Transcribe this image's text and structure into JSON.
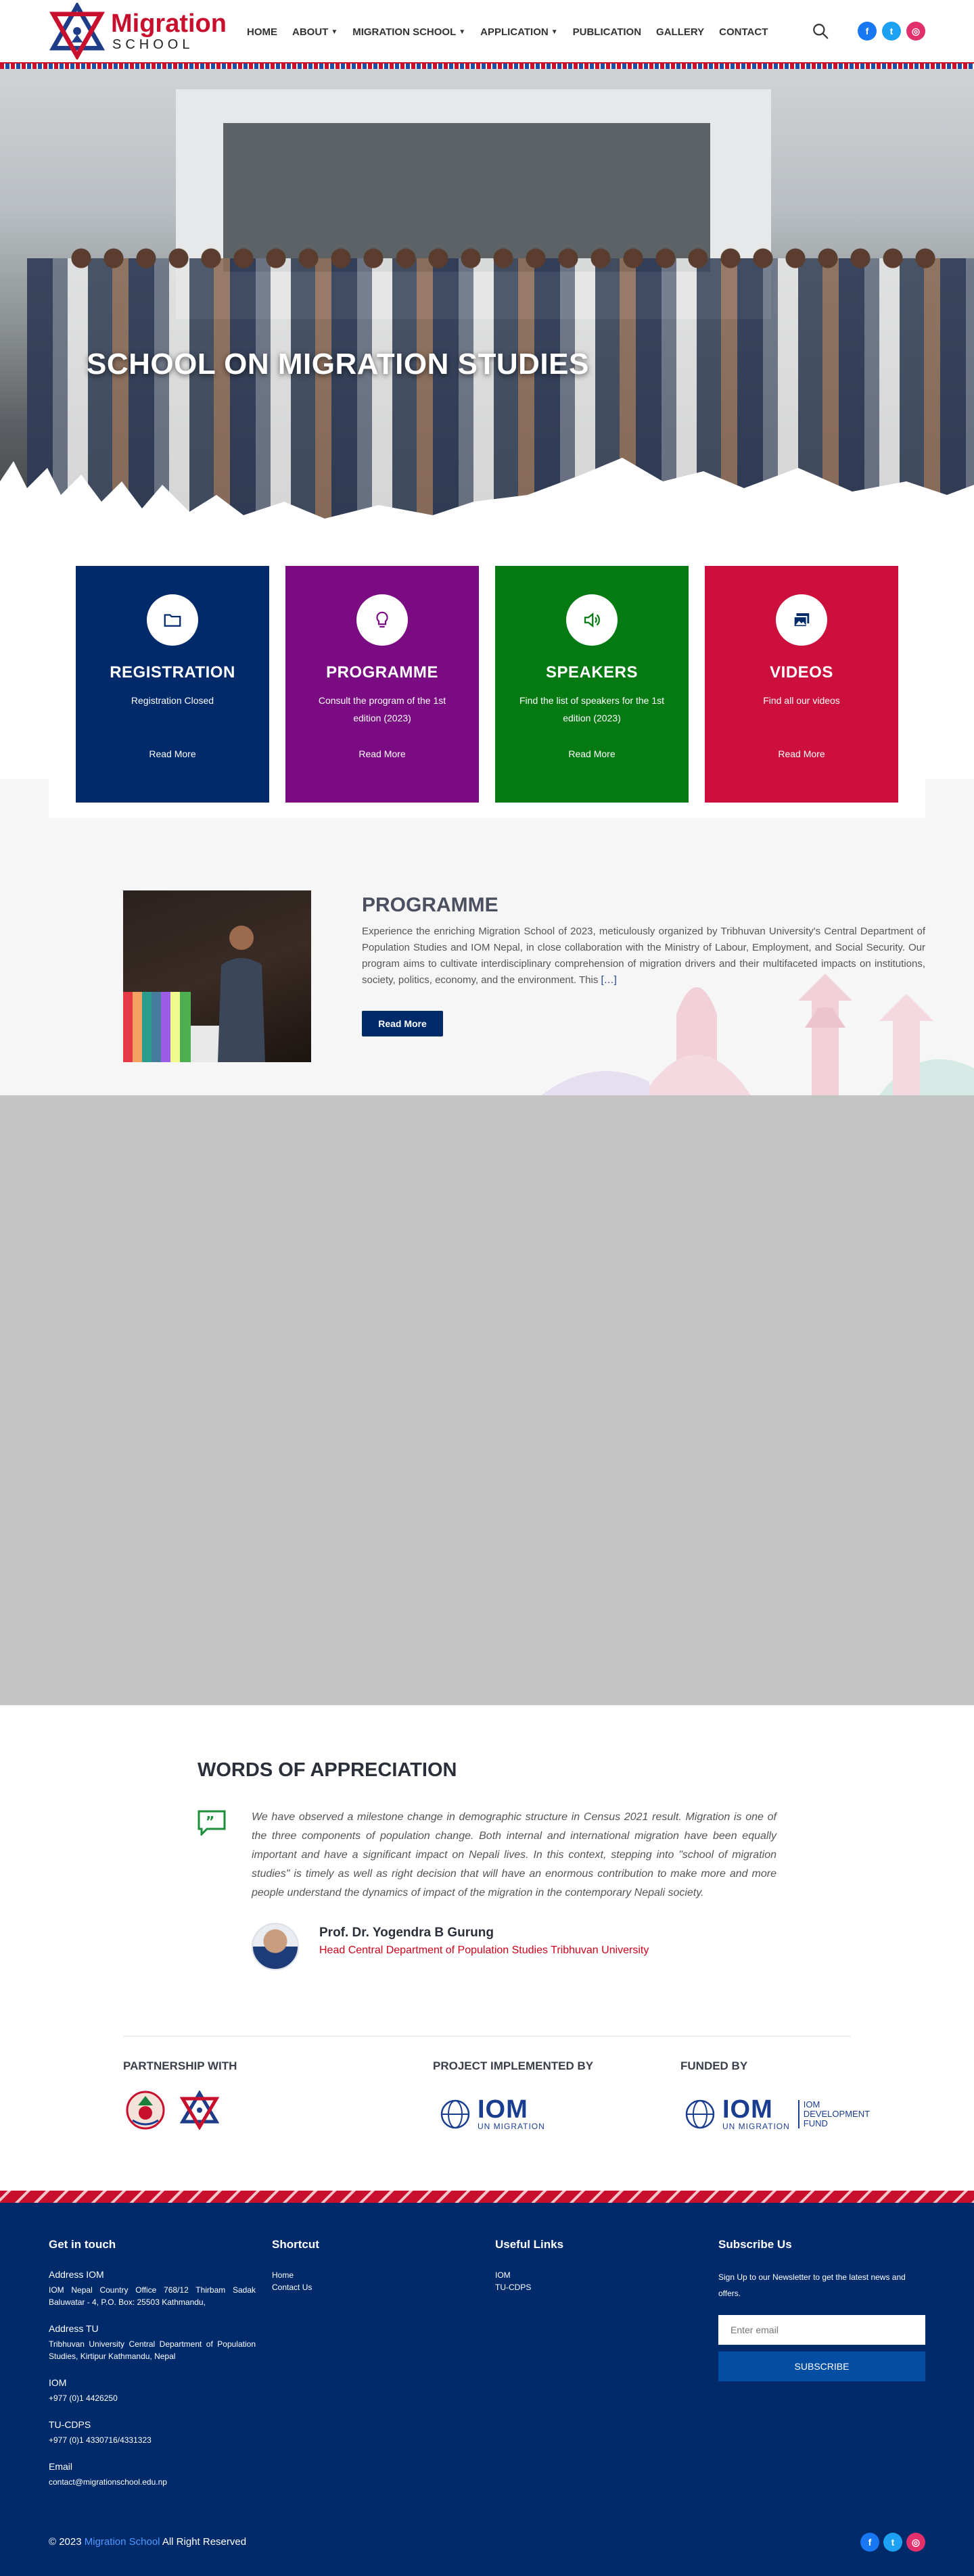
{
  "brand": {
    "name_top": "Migration",
    "name_bottom": "SCHOOL"
  },
  "nav": [
    {
      "label": "HOME",
      "dropdown": false
    },
    {
      "label": "ABOUT",
      "dropdown": true
    },
    {
      "label": "MIGRATION SCHOOL",
      "dropdown": true
    },
    {
      "label": "APPLICATION",
      "dropdown": true
    },
    {
      "label": "PUBLICATION",
      "dropdown": false
    },
    {
      "label": "GALLERY",
      "dropdown": false
    },
    {
      "label": "CONTACT",
      "dropdown": false
    }
  ],
  "social": {
    "facebook": "f",
    "twitter": "t",
    "instagram": "◎"
  },
  "hero": {
    "title": "SCHOOL ON MIGRATION STUDIES"
  },
  "cards": [
    {
      "title": "REGISTRATION",
      "text": "Registration Closed",
      "link": "Read More",
      "color": "#012a6b",
      "icon": "folder-icon"
    },
    {
      "title": "PROGRAMME",
      "text": "Consult the program of the 1st edition (2023)",
      "link": "Read More",
      "color": "#7b0b82",
      "icon": "lightbulb-icon"
    },
    {
      "title": "SPEAKERS",
      "text": "Find the list of speakers for the 1st edition (2023)",
      "link": "Read More",
      "color": "#057a12",
      "icon": "speaker-icon"
    },
    {
      "title": "VIDEOS",
      "text": "Find all our videos",
      "link": "Read More",
      "color": "#cc0f3c",
      "icon": "gallery-icon"
    }
  ],
  "programme": {
    "heading": "PROGRAMME",
    "body": "Experience the enriching Migration School of 2023, meticulously organized by Tribhuvan University's Central Department of Population Studies and IOM Nepal, in close collaboration with the Ministry of Labour, Employment, and Social Security. Our program aims to cultivate interdisciplinary comprehension of migration drivers and their multifaceted impacts on institutions, society, politics, economy, and the environment. This",
    "ellipsis": "[…]",
    "button": "Read More"
  },
  "appreciation": {
    "heading": "WORDS OF APPRECIATION",
    "quote": "We have observed a milestone change in demographic structure in Census 2021 result. Migration is one of the three components of population change. Both internal and international migration have been equally important and have a significant impact on Nepali lives. In this context, stepping into \"school of migration studies\" is timely as well as right decision that will have an enormous contribution to make more and more people understand the dynamics of impact of the migration in the contemporary Nepali society.",
    "name": "Prof. Dr. Yogendra B Gurung",
    "role": "Head Central Department of Population Studies Tribhuvan University"
  },
  "partners": {
    "partnership_label": "PARTNERSHIP WITH",
    "implemented_label": "PROJECT IMPLEMENTED BY",
    "funded_label": "FUNDED BY",
    "iom_big": "IOM",
    "iom_small": "UN MIGRATION",
    "fund_lines": [
      "IOM",
      "DEVELOPMENT",
      "FUND"
    ]
  },
  "footer": {
    "get_in_touch": "Get in touch",
    "contacts": [
      {
        "title": "Address IOM",
        "value": "IOM Nepal Country Office 768/12 Thirbam Sadak Baluwatar - 4, P.O. Box: 25503 Kathmandu,"
      },
      {
        "title": "Address TU",
        "value": "Tribhuvan University Central Department of Population Studies, Kirtipur Kathmandu, Nepal"
      },
      {
        "title": "IOM",
        "value": "+977 (0)1 4426250"
      },
      {
        "title": "TU-CDPS",
        "value": "+977 (0)1 4330716/4331323"
      },
      {
        "title": "Email",
        "value": "contact@migrationschool.edu.np"
      }
    ],
    "shortcut_title": "Shortcut",
    "shortcuts": [
      "Home",
      "Contact Us"
    ],
    "useful_title": "Useful Links",
    "useful": [
      "IOM",
      "TU-CDPS"
    ],
    "subscribe_title": "Subscribe Us",
    "subscribe_text": "Sign Up to our Newsletter to get the latest news and offers.",
    "email_placeholder": "Enter email",
    "subscribe_button": "SUBSCRIBE",
    "copyright_prefix": "© 2023",
    "copyright_brand": "Migration School",
    "copyright_suffix": "All Right Reserved"
  }
}
